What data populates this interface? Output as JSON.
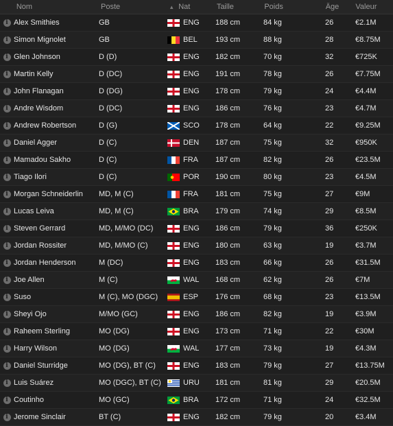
{
  "headers": {
    "name": "Nom",
    "position": "Poste",
    "nat": "Nat",
    "size": "Taille",
    "weight": "Poids",
    "age": "Âge",
    "value": "Valeur"
  },
  "players": [
    {
      "name": "Alex Smithies",
      "position": "GB",
      "nat": "ENG",
      "size": "188 cm",
      "weight": "84 kg",
      "age": "26",
      "value": "€2.1M"
    },
    {
      "name": "Simon Mignolet",
      "position": "GB",
      "nat": "BEL",
      "size": "193 cm",
      "weight": "88 kg",
      "age": "28",
      "value": "€8.75M"
    },
    {
      "name": "Glen Johnson",
      "position": "D (D)",
      "nat": "ENG",
      "size": "182 cm",
      "weight": "70 kg",
      "age": "32",
      "value": "€725K"
    },
    {
      "name": "Martin Kelly",
      "position": "D (DC)",
      "nat": "ENG",
      "size": "191 cm",
      "weight": "78 kg",
      "age": "26",
      "value": "€7.75M"
    },
    {
      "name": "John Flanagan",
      "position": "D (DG)",
      "nat": "ENG",
      "size": "178 cm",
      "weight": "79 kg",
      "age": "24",
      "value": "€4.4M"
    },
    {
      "name": "Andre Wisdom",
      "position": "D (DC)",
      "nat": "ENG",
      "size": "186 cm",
      "weight": "76 kg",
      "age": "23",
      "value": "€4.7M"
    },
    {
      "name": "Andrew Robertson",
      "position": "D (G)",
      "nat": "SCO",
      "size": "178 cm",
      "weight": "64 kg",
      "age": "22",
      "value": "€9.25M"
    },
    {
      "name": "Daniel Agger",
      "position": "D (C)",
      "nat": "DEN",
      "size": "187 cm",
      "weight": "75 kg",
      "age": "32",
      "value": "€950K"
    },
    {
      "name": "Mamadou Sakho",
      "position": "D (C)",
      "nat": "FRA",
      "size": "187 cm",
      "weight": "82 kg",
      "age": "26",
      "value": "€23.5M"
    },
    {
      "name": "Tiago Ilori",
      "position": "D (C)",
      "nat": "POR",
      "size": "190 cm",
      "weight": "80 kg",
      "age": "23",
      "value": "€4.5M"
    },
    {
      "name": "Morgan Schneiderlin",
      "position": "MD, M (C)",
      "nat": "FRA",
      "size": "181 cm",
      "weight": "75 kg",
      "age": "27",
      "value": "€9M"
    },
    {
      "name": "Lucas Leiva",
      "position": "MD, M (C)",
      "nat": "BRA",
      "size": "179 cm",
      "weight": "74 kg",
      "age": "29",
      "value": "€8.5M"
    },
    {
      "name": "Steven Gerrard",
      "position": "MD, M/MO (DC)",
      "nat": "ENG",
      "size": "186 cm",
      "weight": "79 kg",
      "age": "36",
      "value": "€250K"
    },
    {
      "name": "Jordan Rossiter",
      "position": "MD, M/MO (C)",
      "nat": "ENG",
      "size": "180 cm",
      "weight": "63 kg",
      "age": "19",
      "value": "€3.7M"
    },
    {
      "name": "Jordan Henderson",
      "position": "M (DC)",
      "nat": "ENG",
      "size": "183 cm",
      "weight": "66 kg",
      "age": "26",
      "value": "€31.5M"
    },
    {
      "name": "Joe Allen",
      "position": "M (C)",
      "nat": "WAL",
      "size": "168 cm",
      "weight": "62 kg",
      "age": "26",
      "value": "€7M"
    },
    {
      "name": "Suso",
      "position": "M (C), MO (DGC)",
      "nat": "ESP",
      "size": "176 cm",
      "weight": "68 kg",
      "age": "23",
      "value": "€13.5M"
    },
    {
      "name": "Sheyi Ojo",
      "position": "M/MO (GC)",
      "nat": "ENG",
      "size": "186 cm",
      "weight": "82 kg",
      "age": "19",
      "value": "€3.9M"
    },
    {
      "name": "Raheem Sterling",
      "position": "MO (DG)",
      "nat": "ENG",
      "size": "173 cm",
      "weight": "71 kg",
      "age": "22",
      "value": "€30M"
    },
    {
      "name": "Harry Wilson",
      "position": "MO (DG)",
      "nat": "WAL",
      "size": "177 cm",
      "weight": "73 kg",
      "age": "19",
      "value": "€4.3M"
    },
    {
      "name": "Daniel Sturridge",
      "position": "MO (DG), BT (C)",
      "nat": "ENG",
      "size": "183 cm",
      "weight": "79 kg",
      "age": "27",
      "value": "€13.75M"
    },
    {
      "name": "Luis Suárez",
      "position": "MO (DGC), BT (C)",
      "nat": "URU",
      "size": "181 cm",
      "weight": "81 kg",
      "age": "29",
      "value": "€20.5M"
    },
    {
      "name": "Coutinho",
      "position": "MO (GC)",
      "nat": "BRA",
      "size": "172 cm",
      "weight": "71 kg",
      "age": "24",
      "value": "€32.5M"
    },
    {
      "name": "Jerome Sinclair",
      "position": "BT (C)",
      "nat": "ENG",
      "size": "182 cm",
      "weight": "79 kg",
      "age": "20",
      "value": "€3.4M"
    }
  ]
}
